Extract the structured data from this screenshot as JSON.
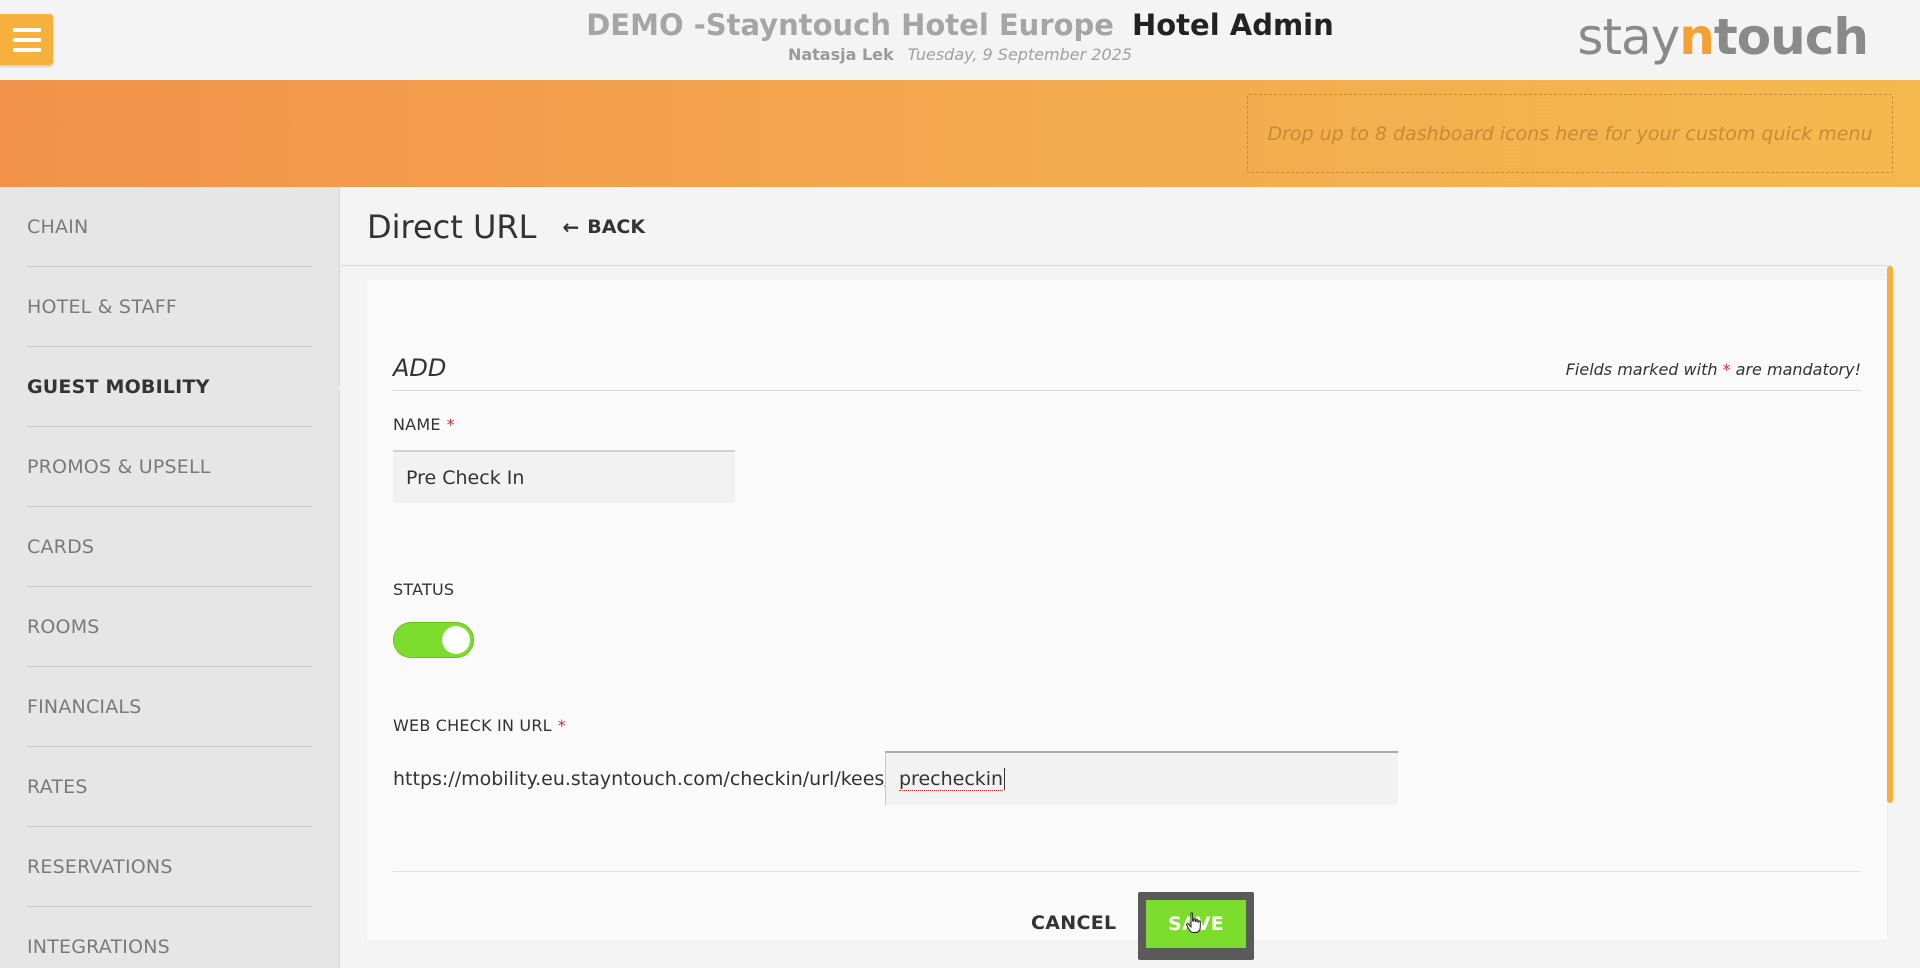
{
  "header": {
    "hotel_name": "DEMO -Stayntouch Hotel Europe",
    "app_name": "Hotel Admin",
    "user": "Natasja Lek",
    "date": "Tuesday, 9 September 2025",
    "logo": {
      "part1": "stay",
      "part2": "n",
      "part3": "touch"
    }
  },
  "quick_menu": {
    "placeholder": "Drop up to 8 dashboard icons here for your custom quick menu"
  },
  "sidebar": {
    "items": [
      {
        "label": "CHAIN"
      },
      {
        "label": "HOTEL & STAFF"
      },
      {
        "label": "GUEST MOBILITY",
        "active": true
      },
      {
        "label": "PROMOS & UPSELL"
      },
      {
        "label": "CARDS"
      },
      {
        "label": "ROOMS"
      },
      {
        "label": "FINANCIALS"
      },
      {
        "label": "RATES"
      },
      {
        "label": "RESERVATIONS"
      },
      {
        "label": "INTEGRATIONS"
      }
    ]
  },
  "page": {
    "title": "Direct URL",
    "back_label": "BACK"
  },
  "form": {
    "section_title": "ADD",
    "mandatory_prefix": "Fields marked with",
    "mandatory_star": "*",
    "mandatory_suffix": "are mandatory!",
    "name_label": "NAME",
    "name_value": "Pre Check In",
    "status_label": "STATUS",
    "status_on": true,
    "url_label": "WEB CHECK IN URL",
    "url_prefix": "https://mobility.eu.stayntouch.com/checkin/url/kees/",
    "url_value": "precheckin",
    "required_star": "*"
  },
  "actions": {
    "cancel_label": "CANCEL",
    "save_label": "SAVE"
  },
  "colors": {
    "accent_orange": "#f5b13c",
    "toggle_green": "#7ddd2c",
    "required_red": "#d03030"
  }
}
